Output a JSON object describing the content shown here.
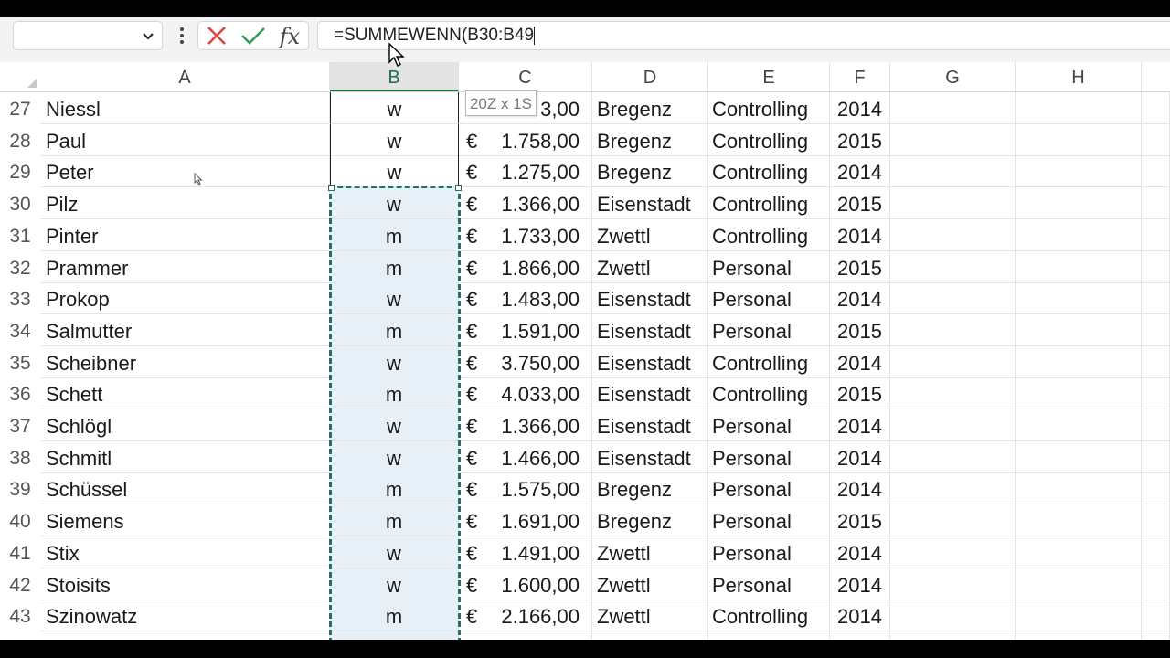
{
  "formula_bar": {
    "name_box_value": "",
    "cancel_icon": "x-icon",
    "enter_icon": "check-icon",
    "function_icon": "fx",
    "formula": "=SUMMEWENN(B30:B49"
  },
  "columns": [
    "A",
    "B",
    "C",
    "D",
    "E",
    "F",
    "G",
    "H"
  ],
  "selected_column": "B",
  "selection_tooltip": "20Z x 1S",
  "accent_color": "#1e7145",
  "selection_border_color": "#2a6b6b",
  "rows": [
    {
      "n": "27",
      "name": "Niessl",
      "sex": "w",
      "cur": "",
      "amount": "3,00",
      "city": "Bregenz",
      "dept": "Controlling",
      "year": "2014"
    },
    {
      "n": "28",
      "name": "Paul",
      "sex": "w",
      "cur": "€",
      "amount": "1.758,00",
      "city": "Bregenz",
      "dept": "Controlling",
      "year": "2015"
    },
    {
      "n": "29",
      "name": "Peter",
      "sex": "w",
      "cur": "€",
      "amount": "1.275,00",
      "city": "Bregenz",
      "dept": "Controlling",
      "year": "2014"
    },
    {
      "n": "30",
      "name": "Pilz",
      "sex": "w",
      "cur": "€",
      "amount": "1.366,00",
      "city": "Eisenstadt",
      "dept": "Controlling",
      "year": "2015"
    },
    {
      "n": "31",
      "name": "Pinter",
      "sex": "m",
      "cur": "€",
      "amount": "1.733,00",
      "city": "Zwettl",
      "dept": "Controlling",
      "year": "2014"
    },
    {
      "n": "32",
      "name": "Prammer",
      "sex": "m",
      "cur": "€",
      "amount": "1.866,00",
      "city": "Zwettl",
      "dept": "Personal",
      "year": "2015"
    },
    {
      "n": "33",
      "name": "Prokop",
      "sex": "w",
      "cur": "€",
      "amount": "1.483,00",
      "city": "Eisenstadt",
      "dept": "Personal",
      "year": "2014"
    },
    {
      "n": "34",
      "name": "Salmutter",
      "sex": "m",
      "cur": "€",
      "amount": "1.591,00",
      "city": "Eisenstadt",
      "dept": "Personal",
      "year": "2015"
    },
    {
      "n": "35",
      "name": "Scheibner",
      "sex": "w",
      "cur": "€",
      "amount": "3.750,00",
      "city": "Eisenstadt",
      "dept": "Controlling",
      "year": "2014"
    },
    {
      "n": "36",
      "name": "Schett",
      "sex": "m",
      "cur": "€",
      "amount": "4.033,00",
      "city": "Eisenstadt",
      "dept": "Controlling",
      "year": "2015"
    },
    {
      "n": "37",
      "name": "Schlögl",
      "sex": "w",
      "cur": "€",
      "amount": "1.366,00",
      "city": "Eisenstadt",
      "dept": "Personal",
      "year": "2014"
    },
    {
      "n": "38",
      "name": "Schmitl",
      "sex": "w",
      "cur": "€",
      "amount": "1.466,00",
      "city": "Eisenstadt",
      "dept": "Personal",
      "year": "2014"
    },
    {
      "n": "39",
      "name": "Schüssel",
      "sex": "m",
      "cur": "€",
      "amount": "1.575,00",
      "city": "Bregenz",
      "dept": "Personal",
      "year": "2014"
    },
    {
      "n": "40",
      "name": "Siemens",
      "sex": "m",
      "cur": "€",
      "amount": "1.691,00",
      "city": "Bregenz",
      "dept": "Personal",
      "year": "2015"
    },
    {
      "n": "41",
      "name": "Stix",
      "sex": "w",
      "cur": "€",
      "amount": "1.491,00",
      "city": "Zwettl",
      "dept": "Personal",
      "year": "2014"
    },
    {
      "n": "42",
      "name": "Stoisits",
      "sex": "w",
      "cur": "€",
      "amount": "1.600,00",
      "city": "Zwettl",
      "dept": "Personal",
      "year": "2014"
    },
    {
      "n": "43",
      "name": "Szinowatz",
      "sex": "m",
      "cur": "€",
      "amount": "2.166,00",
      "city": "Zwettl",
      "dept": "Controlling",
      "year": "2014"
    }
  ]
}
